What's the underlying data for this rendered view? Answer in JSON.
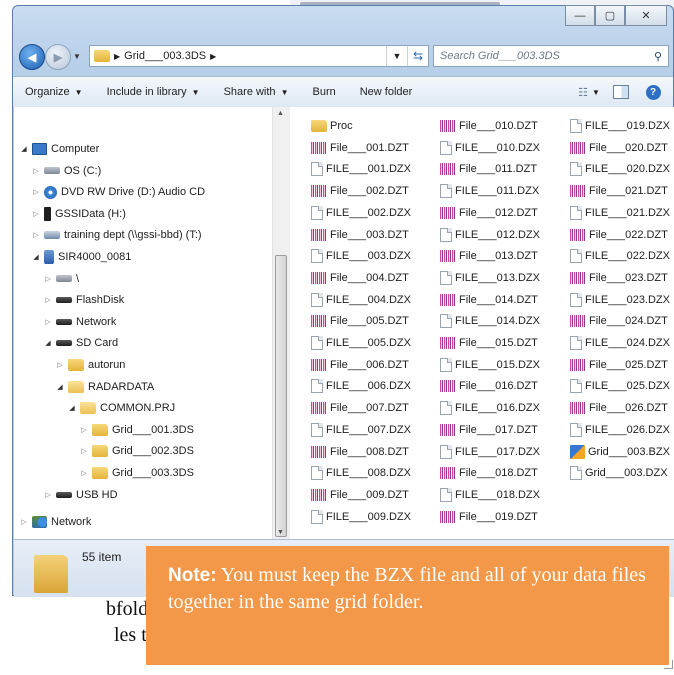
{
  "window": {
    "controls": {
      "minimize": "—",
      "maximize": "▢",
      "close": "✕"
    }
  },
  "address": {
    "crumb": "Grid___003.3DS",
    "search_placeholder": "Search Grid___003.3DS"
  },
  "toolbar": {
    "organize": "Organize",
    "include_in_library": "Include in library",
    "share_with": "Share with",
    "burn": "Burn",
    "new_folder": "New folder"
  },
  "nav_tree": [
    {
      "label": "Computer",
      "icon": "computer",
      "level": 0,
      "expanded": true
    },
    {
      "label": "OS (C:)",
      "icon": "drive",
      "level": 1
    },
    {
      "label": "DVD RW Drive (D:) Audio CD",
      "icon": "cd",
      "level": 1
    },
    {
      "label": "GSSIData (H:)",
      "icon": "usb",
      "level": 1
    },
    {
      "label": "training dept (\\\\gssi-bbd) (T:)",
      "icon": "netdrive",
      "level": 1
    },
    {
      "label": "SIR4000_0081",
      "icon": "device",
      "level": 1,
      "expanded": true
    },
    {
      "label": "\\",
      "icon": "drive",
      "level": 2
    },
    {
      "label": "FlashDisk",
      "icon": "drive-dark",
      "level": 2
    },
    {
      "label": "Network",
      "icon": "drive-dark",
      "level": 2
    },
    {
      "label": "SD Card",
      "icon": "drive-dark",
      "level": 2,
      "expanded": true
    },
    {
      "label": "autorun",
      "icon": "folder",
      "level": 3
    },
    {
      "label": "RADARDATA",
      "icon": "folder",
      "level": 3,
      "expanded": true
    },
    {
      "label": "COMMON.PRJ",
      "icon": "folder",
      "level": 4,
      "expanded": true
    },
    {
      "label": "Grid___001.3DS",
      "icon": "folder",
      "level": 5
    },
    {
      "label": "Grid___002.3DS",
      "icon": "folder",
      "level": 5
    },
    {
      "label": "Grid___003.3DS",
      "icon": "folder",
      "level": 5
    },
    {
      "label": "USB HD",
      "icon": "drive-dark",
      "level": 2
    },
    {
      "label": "Network",
      "icon": "network",
      "level": 0
    }
  ],
  "files": {
    "col1": [
      {
        "name": "Proc",
        "type": "folder"
      },
      {
        "name": "File___001.DZT",
        "type": "radar"
      },
      {
        "name": "FILE___001.DZX",
        "type": "doc"
      },
      {
        "name": "File___002.DZT",
        "type": "radar"
      },
      {
        "name": "FILE___002.DZX",
        "type": "doc"
      },
      {
        "name": "File___003.DZT",
        "type": "radar"
      },
      {
        "name": "FILE___003.DZX",
        "type": "doc"
      },
      {
        "name": "File___004.DZT",
        "type": "radar"
      },
      {
        "name": "FILE___004.DZX",
        "type": "doc"
      },
      {
        "name": "File___005.DZT",
        "type": "radar"
      },
      {
        "name": "FILE___005.DZX",
        "type": "doc"
      },
      {
        "name": "File___006.DZT",
        "type": "radar"
      },
      {
        "name": "FILE___006.DZX",
        "type": "doc"
      },
      {
        "name": "File___007.DZT",
        "type": "radar"
      },
      {
        "name": "FILE___007.DZX",
        "type": "doc"
      },
      {
        "name": "File___008.DZT",
        "type": "radar"
      },
      {
        "name": "FILE___008.DZX",
        "type": "doc"
      },
      {
        "name": "File___009.DZT",
        "type": "radar"
      },
      {
        "name": "FILE___009.DZX",
        "type": "doc"
      }
    ],
    "col2": [
      {
        "name": "File___010.DZT",
        "type": "radar"
      },
      {
        "name": "FILE___010.DZX",
        "type": "doc"
      },
      {
        "name": "File___011.DZT",
        "type": "radar"
      },
      {
        "name": "FILE___011.DZX",
        "type": "doc"
      },
      {
        "name": "File___012.DZT",
        "type": "radar"
      },
      {
        "name": "FILE___012.DZX",
        "type": "doc"
      },
      {
        "name": "File___013.DZT",
        "type": "radar"
      },
      {
        "name": "FILE___013.DZX",
        "type": "doc"
      },
      {
        "name": "File___014.DZT",
        "type": "radar"
      },
      {
        "name": "FILE___014.DZX",
        "type": "doc"
      },
      {
        "name": "File___015.DZT",
        "type": "radar"
      },
      {
        "name": "FILE___015.DZX",
        "type": "doc"
      },
      {
        "name": "File___016.DZT",
        "type": "radar"
      },
      {
        "name": "FILE___016.DZX",
        "type": "doc"
      },
      {
        "name": "File___017.DZT",
        "type": "radar"
      },
      {
        "name": "FILE___017.DZX",
        "type": "doc"
      },
      {
        "name": "File___018.DZT",
        "type": "radar"
      },
      {
        "name": "FILE___018.DZX",
        "type": "doc"
      },
      {
        "name": "File___019.DZT",
        "type": "radar"
      }
    ],
    "col3": [
      {
        "name": "FILE___019.DZX",
        "type": "doc"
      },
      {
        "name": "File___020.DZT",
        "type": "radar"
      },
      {
        "name": "FILE___020.DZX",
        "type": "doc"
      },
      {
        "name": "File___021.DZT",
        "type": "radar"
      },
      {
        "name": "FILE___021.DZX",
        "type": "doc"
      },
      {
        "name": "File___022.DZT",
        "type": "radar"
      },
      {
        "name": "FILE___022.DZX",
        "type": "doc"
      },
      {
        "name": "File___023.DZT",
        "type": "radar"
      },
      {
        "name": "FILE___023.DZX",
        "type": "doc"
      },
      {
        "name": "File___024.DZT",
        "type": "radar"
      },
      {
        "name": "FILE___024.DZX",
        "type": "doc"
      },
      {
        "name": "File___025.DZT",
        "type": "radar"
      },
      {
        "name": "FILE___025.DZX",
        "type": "doc"
      },
      {
        "name": "File___026.DZT",
        "type": "radar"
      },
      {
        "name": "FILE___026.DZX",
        "type": "doc"
      },
      {
        "name": "Grid___003.BZX",
        "type": "grid"
      },
      {
        "name": "Grid___003.DZX",
        "type": "doc"
      }
    ]
  },
  "status": {
    "item_count": "55 item"
  },
  "note": {
    "label": "Note:",
    "text": " You must keep the BZX file and all of your data files together in the same grid folder."
  },
  "background_text": {
    "line1": "bfolder",
    "line2": "les that"
  },
  "colors": {
    "note_bg": "#f39748",
    "window_frame": "#b7cfe9"
  }
}
